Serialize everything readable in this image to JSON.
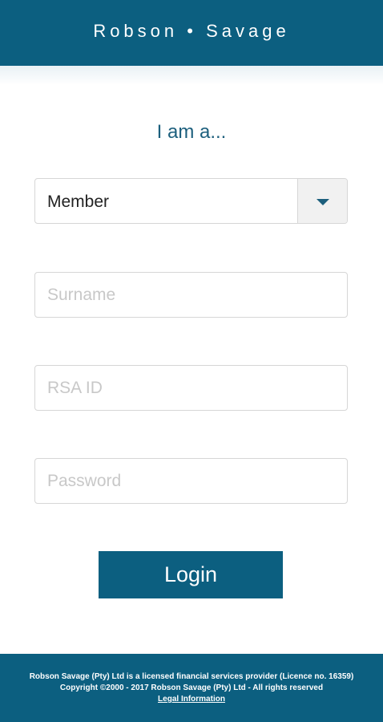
{
  "header": {
    "brand": "Robson • Savage"
  },
  "form": {
    "heading": "I am a...",
    "role_select": {
      "selected": "Member"
    },
    "surname": {
      "placeholder": "Surname",
      "value": ""
    },
    "rsa_id": {
      "placeholder": "RSA ID",
      "value": ""
    },
    "password": {
      "placeholder": "Password",
      "value": ""
    },
    "login_label": "Login"
  },
  "footer": {
    "line1": "Robson Savage (Pty) Ltd is a licensed financial services provider (Licence no. 16359)",
    "line2": "Copyright ©2000 - 2017 Robson Savage (Pty) Ltd - All rights reserved",
    "legal_link": "Legal Information"
  },
  "colors": {
    "brand_blue": "#0c5f80",
    "heading_blue": "#1c5f7d",
    "border_gray": "#d6d6d6",
    "placeholder_gray": "#c8c8c8"
  },
  "icons": {
    "select_caret": "chevron-down-icon"
  }
}
